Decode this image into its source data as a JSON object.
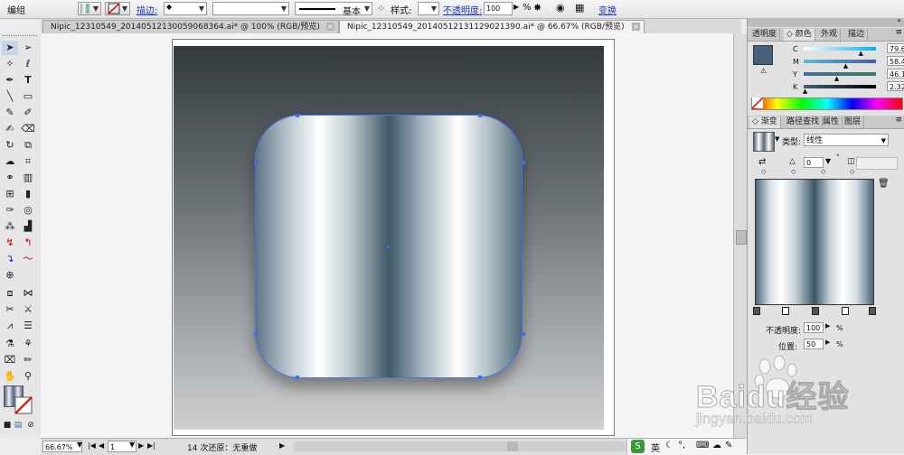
{
  "control_bar": {
    "selection_label": "编组",
    "stroke_label": "描边:",
    "brush_label": "基本",
    "style_label": "样式:",
    "opacity_label": "不透明度:",
    "opacity_value": "100",
    "opacity_unit": "%",
    "transform_label": "变换"
  },
  "tabs": [
    {
      "label": "Nipic_12310549_20140512130059068364.ai* @ 100% (RGB/预览)"
    },
    {
      "label": "Nipic_12310549_20140512131129021390.ai* @ 66.67% (RGB/预览)"
    }
  ],
  "status": {
    "zoom": "66.67%",
    "page": "1",
    "undo": "14 次还原：无重做"
  },
  "color_panel": {
    "tabs": [
      "透明度",
      "颜色",
      "外观",
      "描边"
    ],
    "sliders": [
      {
        "label": "C",
        "value": "79.6",
        "fill": 0.796
      },
      {
        "label": "M",
        "value": "58.42",
        "fill": 0.5842
      },
      {
        "label": "Y",
        "value": "46.1",
        "fill": 0.461
      },
      {
        "label": "K",
        "value": "2.32",
        "fill": 0.0232
      }
    ],
    "swatch_color": "#46627a"
  },
  "gradient_panel": {
    "tabs": [
      "渐变",
      "路径查找",
      "属性",
      "图层"
    ],
    "type_label": "类型:",
    "type_value": "线性",
    "angle_value": "0",
    "opacity_label": "不透明度:",
    "opacity_value": "100",
    "opacity_unit": "%",
    "position_label": "位置:",
    "position_value": "50",
    "position_unit": "%"
  },
  "watermark": {
    "brand": "Baidu经验",
    "url": "jingyan.baidu.com"
  },
  "taskbar": {
    "ime_label": "英"
  }
}
